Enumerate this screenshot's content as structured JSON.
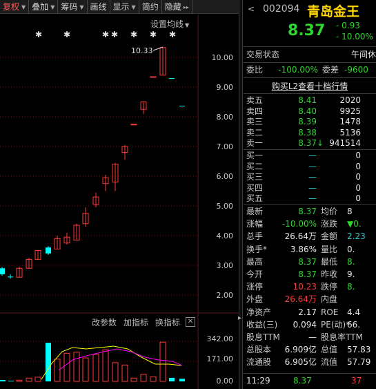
{
  "toolbar": {
    "items": [
      {
        "label": "复权",
        "caret": true,
        "active": true
      },
      {
        "label": "叠加",
        "caret": true
      },
      {
        "label": "筹码",
        "caret": true
      },
      {
        "label": "画线"
      },
      {
        "label": "显示",
        "caret": true
      },
      {
        "label": "简约"
      },
      {
        "label": "隐藏",
        "suffix": "▸▸"
      }
    ]
  },
  "chart": {
    "ma_setting_label": "设置均线",
    "high_annotation": "10.33",
    "price_axis_labels": [
      "10.00",
      "9.00",
      "8.00",
      "7.00",
      "6.00",
      "5.00",
      "4.00",
      "3.00",
      "2.00"
    ],
    "indicator_buttons": [
      "改参数",
      "加指标",
      "换指标"
    ],
    "indicator_close": "✕",
    "volume_axis_labels": [
      "342.00",
      "171.00",
      "0.00"
    ],
    "colors": {
      "up": "#ff3b3b",
      "down": "#00ffff",
      "ma1": "#ffff00",
      "ma2": "#ff00ff",
      "grid": "#5a1a1a"
    }
  },
  "stock": {
    "code": "002094",
    "name": "青岛金王",
    "price": "8.37",
    "change": "- 0.93",
    "change_pct": "- 10.00%",
    "nav_icon": "<"
  },
  "trade": {
    "status_label": "交易状态",
    "status_value": "午间休",
    "weibi_label": "委比",
    "weibi_value": "-100.00%",
    "weicha_label": "委差",
    "weicha_value": "-9600",
    "l2_link": "购买L2查看十档行情"
  },
  "order_book": {
    "asks": [
      {
        "label": "卖五",
        "price": "8.41",
        "vol": "2020"
      },
      {
        "label": "卖四",
        "price": "8.40",
        "vol": "9925"
      },
      {
        "label": "卖三",
        "price": "8.39",
        "vol": "1478"
      },
      {
        "label": "卖二",
        "price": "8.38",
        "vol": "5136"
      },
      {
        "label": "卖一",
        "price": "8.37",
        "vol": "941514",
        "arrow": "↓"
      }
    ],
    "bids": [
      {
        "label": "买一",
        "price": "—",
        "vol": "0"
      },
      {
        "label": "买二",
        "price": "—",
        "vol": "0"
      },
      {
        "label": "买三",
        "price": "—",
        "vol": "0"
      },
      {
        "label": "买四",
        "price": "—",
        "vol": "0"
      },
      {
        "label": "买五",
        "price": "—",
        "vol": "0"
      }
    ]
  },
  "quote": [
    {
      "l1": "最新",
      "v1": "8.37",
      "c1": "green",
      "l2": "均价",
      "v2": "8",
      "c2": "white"
    },
    {
      "l1": "涨幅",
      "v1": "-10.00%",
      "c1": "green",
      "l2": "涨跌",
      "v2": "▼0.",
      "c2": "green"
    },
    {
      "l1": "总手",
      "v1": "26.64万",
      "c1": "white",
      "l2": "金额",
      "v2": "2.23",
      "c2": "cyan"
    },
    {
      "l1": "换手*",
      "v1": "3.86%",
      "c1": "white",
      "l2": "量比",
      "v2": "0.",
      "c2": "white"
    },
    {
      "l1": "最高",
      "v1": "8.37",
      "c1": "green",
      "l2": "最低",
      "v2": "8.",
      "c2": "green"
    },
    {
      "l1": "今开",
      "v1": "8.37",
      "c1": "green",
      "l2": "昨收",
      "v2": "9.",
      "c2": "white"
    },
    {
      "l1": "涨停",
      "v1": "10.23",
      "c1": "red",
      "l2": "跌停",
      "v2": "8.",
      "c2": "green"
    },
    {
      "l1": "外盘",
      "v1": "26.64万",
      "c1": "red",
      "l2": "内盘",
      "v2": "",
      "c2": "green"
    },
    {
      "l1": "净资产",
      "v1": "2.17",
      "c1": "white",
      "l2": "ROE",
      "v2": "4.4",
      "c2": "white"
    },
    {
      "l1": "收益(三)",
      "v1": "0.094",
      "c1": "white",
      "l2": "PE(动)*",
      "v2": "66.",
      "c2": "white"
    },
    {
      "l1": "股息TTM",
      "v1": "—",
      "c1": "white",
      "l2": "股息率TTM",
      "v2": "",
      "c2": "white"
    },
    {
      "l1": "总股本",
      "v1": "6.909亿",
      "c1": "white",
      "l2": "总值",
      "v2": "57.83",
      "c2": "white"
    },
    {
      "l1": "流通股",
      "v1": "6.905亿",
      "c1": "white",
      "l2": "流值",
      "v2": "57.79",
      "c2": "white"
    }
  ],
  "footer": {
    "time": "11:29",
    "price": "8.37",
    "vol": "37"
  }
}
